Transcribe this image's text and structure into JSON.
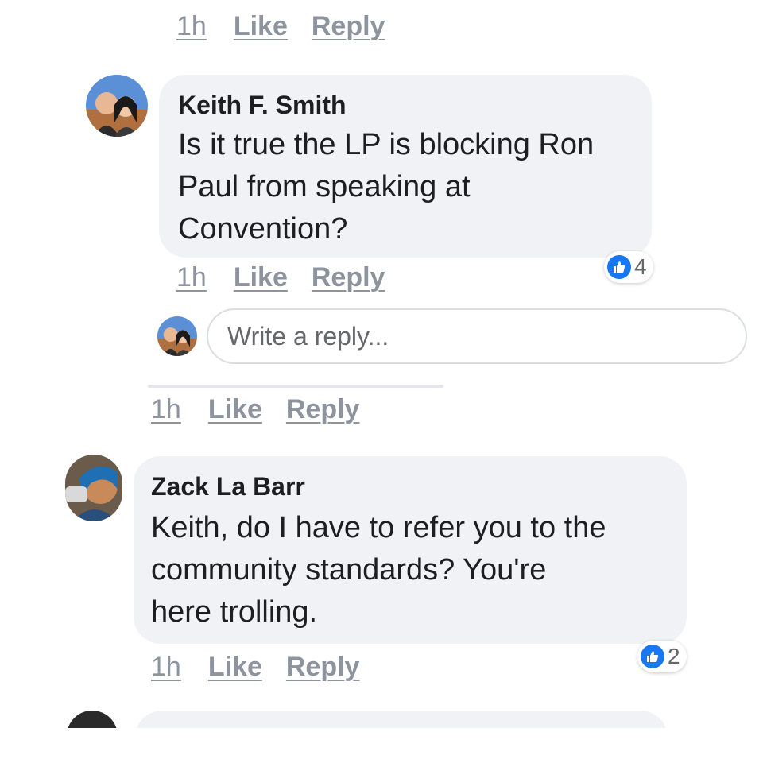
{
  "top_actions": {
    "time": "1h",
    "like": "Like",
    "reply": "Reply"
  },
  "comments": [
    {
      "author": "Keith F. Smith",
      "text_lines": [
        "Is it true the LP is blocking Ron",
        "Paul from speaking at",
        "Convention?"
      ],
      "reaction_count": "4",
      "time": "1h",
      "like": "Like",
      "reply": "Reply"
    },
    {
      "author": "Zack La Barr",
      "text_lines": [
        "Keith, do I have to refer you to the",
        "community standards? You're",
        "here trolling."
      ],
      "reaction_count": "2",
      "time": "1h",
      "like": "Like",
      "reply": "Reply"
    }
  ],
  "reply_box": {
    "placeholder": "Write a reply..."
  },
  "parent_actions": {
    "time": "1h",
    "like": "Like",
    "reply": "Reply"
  },
  "colors": {
    "bubble": "#f0f2f5",
    "like_blue": "#1877f2",
    "muted": "#8d949e"
  }
}
